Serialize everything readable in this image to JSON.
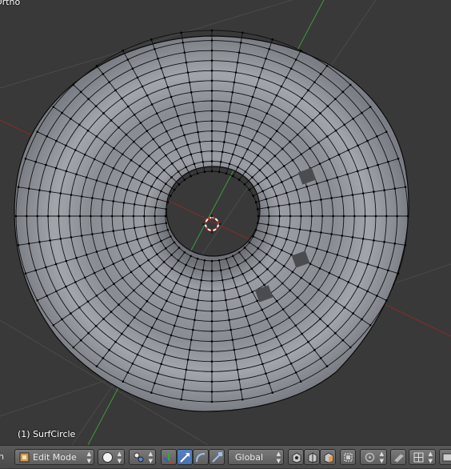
{
  "viewport": {
    "view_label": "Ortho",
    "object_label": "(1) SurfCircle",
    "colors": {
      "background": "#393939",
      "grid": "#4a4a4a",
      "x_axis": "#8a2a2a",
      "y_axis": "#3c9a3c",
      "mesh_fill": "#8c8e96",
      "wire": "#0a0a0a"
    }
  },
  "header": {
    "left_cut_text": "h",
    "mode": {
      "label": "Edit Mode",
      "icon": "edit-mode-icon"
    },
    "shading": {
      "icon": "solid-sphere-icon"
    },
    "pivot": {
      "icon": "pivot-point-icon"
    },
    "manipulators": [
      {
        "icon": "manipulator-toggle-icon",
        "active": false
      },
      {
        "icon": "translate-arrow-icon",
        "active": true
      },
      {
        "icon": "rotate-arc-icon",
        "active": false
      },
      {
        "icon": "scale-icon",
        "active": false
      }
    ],
    "orientation": {
      "label": "Global"
    },
    "select_modes": [
      {
        "icon": "vertex-select-icon"
      },
      {
        "icon": "edge-select-icon"
      },
      {
        "icon": "face-select-icon"
      }
    ],
    "occlude": {
      "icon": "limit-selection-icon"
    },
    "proportional": {
      "icon": "proportional-edit-icon"
    },
    "snap": {
      "icon": "magnet-snap-icon"
    },
    "snap_target": {
      "icon": "snap-target-icon"
    },
    "extra": {
      "icon": "render-icon"
    }
  }
}
